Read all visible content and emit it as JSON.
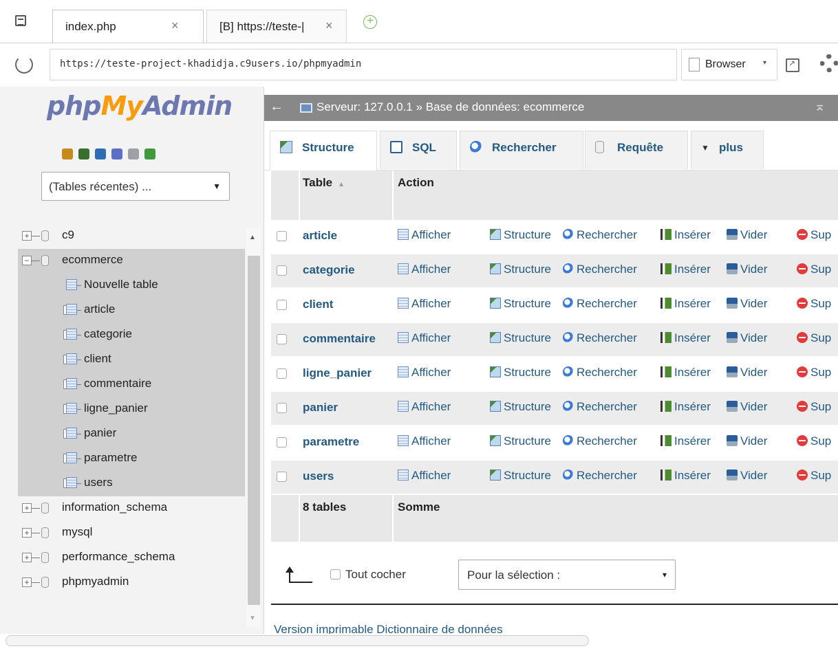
{
  "browser": {
    "tabs": [
      {
        "label": "index.php",
        "close": "×"
      },
      {
        "label": "[B] https://teste-|",
        "close": "×"
      }
    ],
    "new_tab_glyph": "+",
    "url": "https://teste-project-khadidja.c9users.io/phpmyadmin",
    "browser_button": "Browser",
    "browser_caret": "▾"
  },
  "sidebar": {
    "logo": {
      "php": "php",
      "my": "My",
      "admin": "Admin"
    },
    "nav_icons": [
      "home-icon",
      "logout-icon",
      "sql-query-icon",
      "help-icon",
      "docs-icon",
      "reload-icon"
    ],
    "nav_icon_colors": [
      "#c58a1a",
      "#3b6e2e",
      "#2f6db3",
      "#5b6fc6",
      "#9aa0a6",
      "#3f9a3f"
    ],
    "recent_tables": "(Tables récentes) ...",
    "tree": [
      {
        "label": "c9",
        "type": "db",
        "level": 0,
        "toggle": "+"
      },
      {
        "label": "ecommerce",
        "type": "db",
        "level": 0,
        "toggle": "−"
      },
      {
        "label": "Nouvelle table",
        "type": "new",
        "level": 1,
        "toggle": ""
      },
      {
        "label": "article",
        "type": "table",
        "level": 1,
        "toggle": "+"
      },
      {
        "label": "categorie",
        "type": "table",
        "level": 1,
        "toggle": "+"
      },
      {
        "label": "client",
        "type": "table",
        "level": 1,
        "toggle": "+"
      },
      {
        "label": "commentaire",
        "type": "table",
        "level": 1,
        "toggle": "+"
      },
      {
        "label": "ligne_panier",
        "type": "table",
        "level": 1,
        "toggle": "+"
      },
      {
        "label": "panier",
        "type": "table",
        "level": 1,
        "toggle": "+"
      },
      {
        "label": "parametre",
        "type": "table",
        "level": 1,
        "toggle": "+"
      },
      {
        "label": "users",
        "type": "table",
        "level": 1,
        "toggle": "+"
      },
      {
        "label": "information_schema",
        "type": "db",
        "level": 0,
        "toggle": "+"
      },
      {
        "label": "mysql",
        "type": "db",
        "level": 0,
        "toggle": "+"
      },
      {
        "label": "performance_schema",
        "type": "db",
        "level": 0,
        "toggle": "+"
      },
      {
        "label": "phpmyadmin",
        "type": "db",
        "level": 0,
        "toggle": "+"
      }
    ]
  },
  "breadcrumb": {
    "text": "Serveur: 127.0.0.1 » Base de données: ecommerce",
    "back": "←",
    "collapse": "⌅"
  },
  "tabs": [
    {
      "label": "Structure",
      "icon": "structure-icon",
      "active": true
    },
    {
      "label": "SQL",
      "icon": "sql-icon",
      "active": false
    },
    {
      "label": "Rechercher",
      "icon": "search-icon",
      "active": false
    },
    {
      "label": "Requête",
      "icon": "query-icon",
      "active": false
    },
    {
      "label": "plus",
      "icon": "dropdown-triangle-icon",
      "active": false
    }
  ],
  "table": {
    "headers": {
      "table": "Table",
      "action": "Action",
      "sort_glyph": "▲"
    },
    "actions": [
      "Afficher",
      "Structure",
      "Rechercher",
      "Insérer",
      "Vider",
      "Sup"
    ],
    "rows": [
      "article",
      "categorie",
      "client",
      "commentaire",
      "ligne_panier",
      "panier",
      "parametre",
      "users"
    ],
    "footer": {
      "count": "8 tables",
      "sum": "Somme"
    }
  },
  "bulk": {
    "check_all": "Tout cocher",
    "selection_placeholder": "Pour la sélection :",
    "selection_caret": "▾"
  },
  "print_links": "Version imprimable    Dictionnaire de données"
}
